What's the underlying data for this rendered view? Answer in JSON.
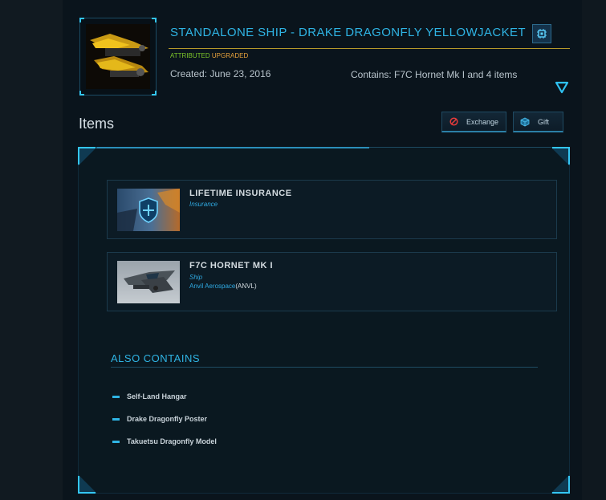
{
  "header": {
    "title": "STANDALONE SHIP - DRAKE DRAGONFLY YELLOWJACKET",
    "tag_attributed": "ATTRIBUTED",
    "tag_upgraded": "UPGRADED",
    "created": "Created: June 23, 2016",
    "contains": "Contains: F7C Hornet Mk I and 4 items"
  },
  "items_heading": "Items",
  "actions": {
    "exchange_label": "Exchange",
    "gift_label": "Gift"
  },
  "items": [
    {
      "name": "LIFETIME INSURANCE",
      "type": "Insurance"
    },
    {
      "name": "F7C HORNET MK I",
      "type": "Ship",
      "manufacturer": "Anvil Aerospace",
      "manufacturer_code": "(ANVL)"
    }
  ],
  "also_contains": {
    "heading": "ALSO CONTAINS",
    "items": [
      "Self-Land Hangar",
      "Drake Dragonfly Poster",
      "Takuetsu Dragonfly Model"
    ]
  },
  "colors": {
    "accent": "#2fb4e4",
    "attributed": "#7cc62a",
    "upgraded": "#e6a23b",
    "exchange_icon": "#e53b3b"
  },
  "icons": [
    "ship-thumbnail",
    "chip-icon",
    "triangle-down-icon",
    "no-entry-icon",
    "gift-cube-icon",
    "insurance-shield-icon",
    "hornet-ship-image"
  ]
}
